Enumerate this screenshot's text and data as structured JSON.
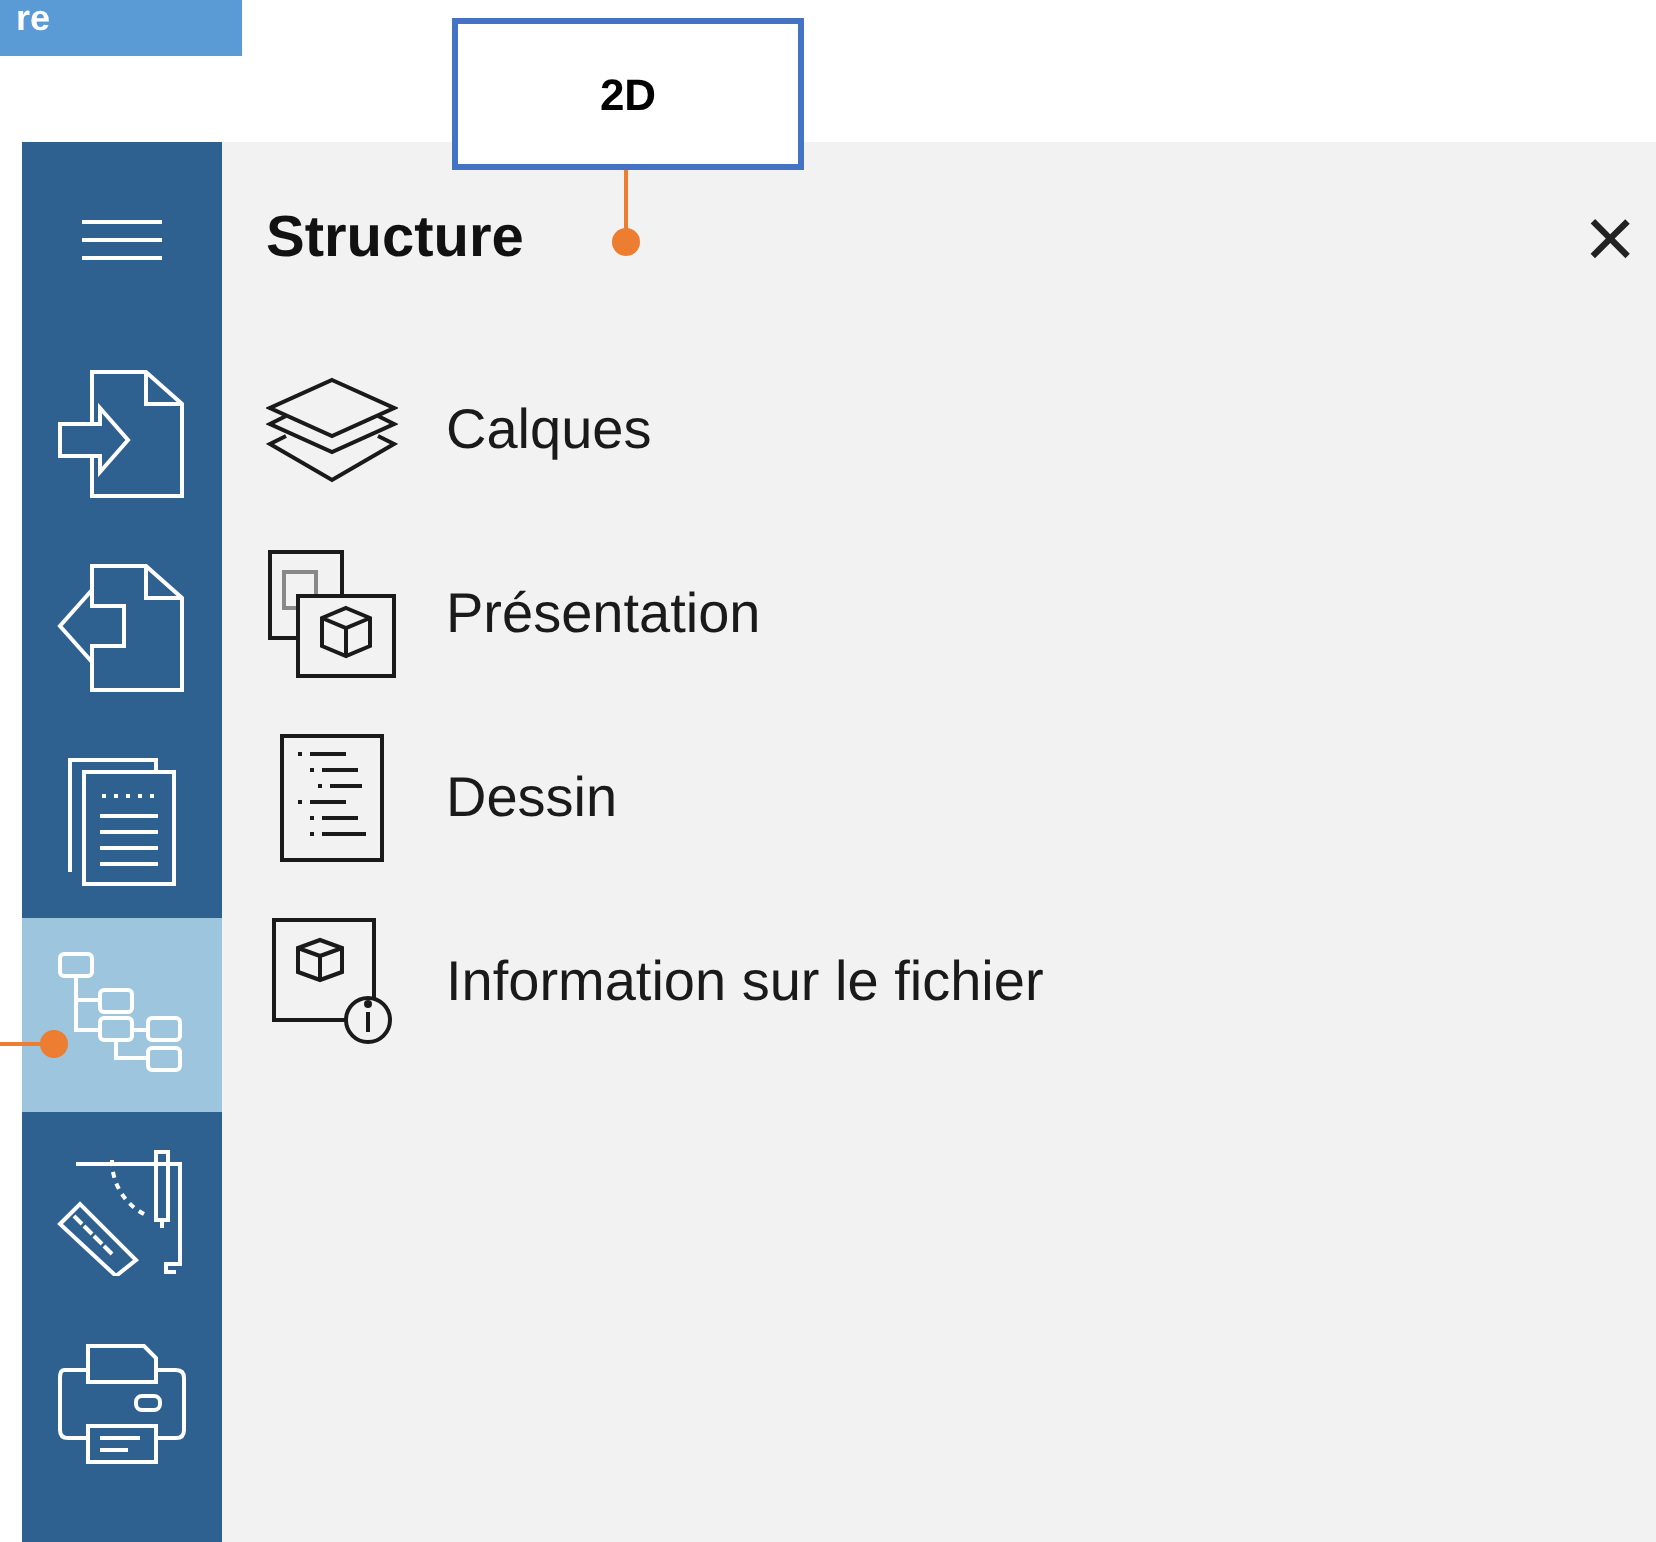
{
  "top_label": "re",
  "callout": {
    "text": "2D"
  },
  "sidebar": {
    "items": [
      {
        "kind": "menu",
        "selected": false
      },
      {
        "kind": "import",
        "selected": false
      },
      {
        "kind": "export",
        "selected": false
      },
      {
        "kind": "pages",
        "selected": false
      },
      {
        "kind": "structure",
        "selected": true
      },
      {
        "kind": "drawing",
        "selected": false
      },
      {
        "kind": "print",
        "selected": false
      }
    ]
  },
  "panel": {
    "title": "Structure",
    "close": "×",
    "items": [
      {
        "kind": "layers",
        "label": "Calques"
      },
      {
        "kind": "layout",
        "label": "Présentation"
      },
      {
        "kind": "drawing",
        "label": "Dessin"
      },
      {
        "kind": "fileinfo",
        "label": "Information sur le fichier"
      }
    ]
  }
}
